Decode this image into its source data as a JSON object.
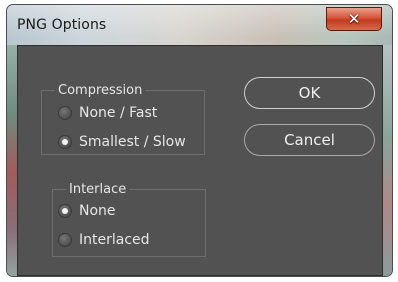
{
  "window": {
    "title": "PNG Options"
  },
  "compression": {
    "legend": "Compression",
    "options": [
      {
        "label": "None / Fast",
        "checked": false
      },
      {
        "label": "Smallest / Slow",
        "checked": true
      }
    ]
  },
  "interlace": {
    "legend": "Interlace",
    "options": [
      {
        "label": "None",
        "checked": true
      },
      {
        "label": "Interlaced",
        "checked": false
      }
    ]
  },
  "buttons": {
    "ok": "OK",
    "cancel": "Cancel"
  },
  "icons": {
    "close": "close-x-icon",
    "close_glyph": "✕"
  },
  "colors": {
    "dialog_background": "#525252",
    "text": "#e6e6e6",
    "close_button": "#d6543a"
  }
}
